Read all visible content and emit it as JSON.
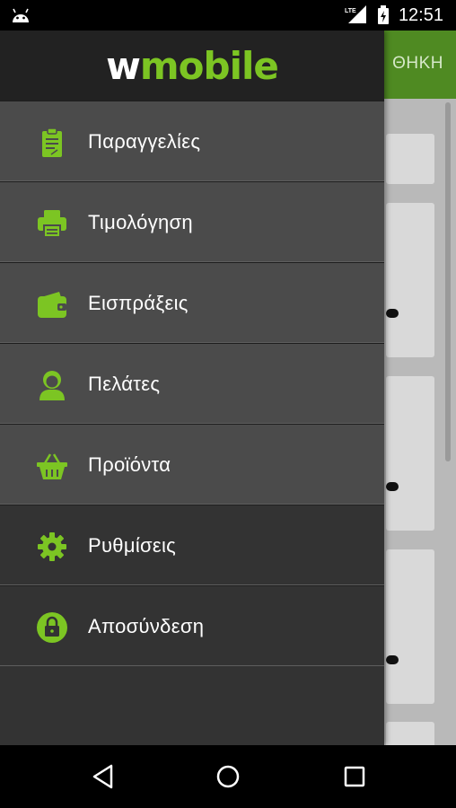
{
  "status_bar": {
    "network": "LTE",
    "time": "12:51"
  },
  "background_app": {
    "toolbar_title": "ΘΗΚΗ"
  },
  "drawer": {
    "logo": {
      "part1": "w",
      "part2": "mobile"
    },
    "items": [
      {
        "label": "Παραγγελίες",
        "icon": "clipboard-icon"
      },
      {
        "label": "Τιμολόγηση",
        "icon": "printer-icon"
      },
      {
        "label": "Εισπράξεις",
        "icon": "wallet-icon"
      },
      {
        "label": "Πελάτες",
        "icon": "customer-icon"
      },
      {
        "label": "Προϊόντα",
        "icon": "basket-icon"
      },
      {
        "label": "Ρυθμίσεις",
        "icon": "gear-icon"
      },
      {
        "label": "Αποσύνδεση",
        "icon": "lock-icon"
      }
    ]
  },
  "colors": {
    "accent": "#7cc523",
    "drawer_bg": "#333333",
    "item_light": "#4b4b4b",
    "header_bg": "#222222",
    "toolbar_bg": "#4f8a22"
  }
}
